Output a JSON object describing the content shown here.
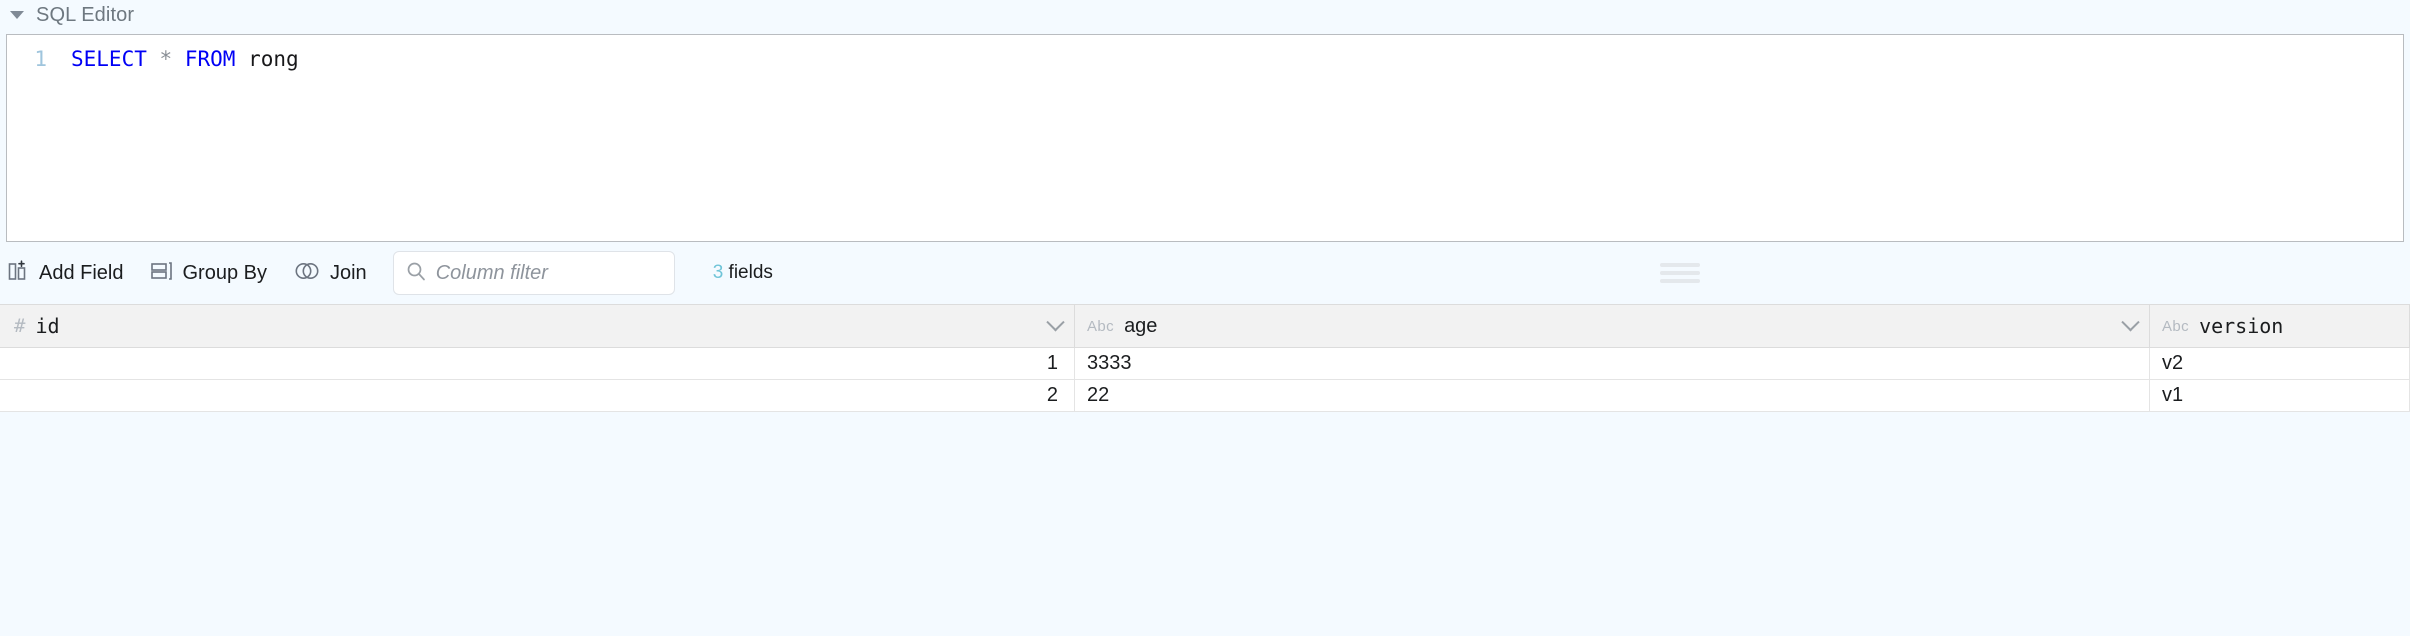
{
  "section": {
    "title": "SQL Editor",
    "caret_icon": "triangle-down-icon",
    "expanded": true
  },
  "editor": {
    "line_number": "1",
    "keyword_select": "SELECT",
    "star": "*",
    "keyword_from": "FROM",
    "table_name": "rong",
    "full_query": "SELECT * FROM rong",
    "keyword_color": "#0000f5",
    "star_color": "#8a8f96",
    "table_color": "#18181a",
    "gutter_color": "#9fc5dd"
  },
  "toolbar": {
    "add_field_label": "Add Field",
    "add_field_icon": "add-field-icon",
    "group_by_label": "Group By",
    "group_by_icon": "group-by-icon",
    "join_label": "Join",
    "join_icon": "join-venn-icon",
    "search_icon": "search-icon",
    "filter_placeholder": "Column filter",
    "filter_value": "",
    "fields_count": "3",
    "fields_label": "fields",
    "fields_count_color": "#6fc4d8",
    "drag_handle_icon": "drag-handle-icon"
  },
  "grid": {
    "columns": [
      {
        "name": "id",
        "type_icon": "#",
        "type_label": "number",
        "font": "mono",
        "align": "right",
        "has_menu": true
      },
      {
        "name": "age",
        "type_icon": "Abc",
        "type_label": "text",
        "font": "sans",
        "align": "left",
        "has_menu": true
      },
      {
        "name": "version",
        "type_icon": "Abc",
        "type_label": "text",
        "font": "mono",
        "align": "left",
        "has_menu": false
      }
    ],
    "rows": [
      {
        "id": "1",
        "age": "3333",
        "version": "v2"
      },
      {
        "id": "2",
        "age": "22",
        "version": "v1"
      }
    ]
  },
  "colors": {
    "page_bg": "#f4faff",
    "editor_bg": "#ffffff",
    "header_row_bg": "#f2f2f2",
    "border": "#dcdcdc"
  }
}
